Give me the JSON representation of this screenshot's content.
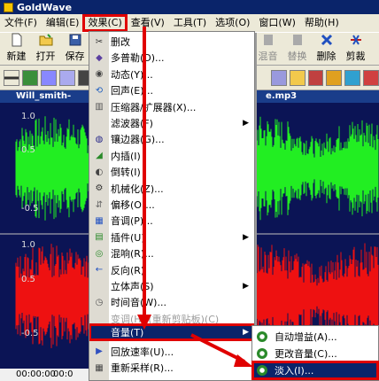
{
  "window": {
    "title": "GoldWave"
  },
  "menubar": [
    {
      "label": "文件(F)"
    },
    {
      "label": "编辑(E)"
    },
    {
      "label": "效果(C)",
      "active": true
    },
    {
      "label": "查看(V)"
    },
    {
      "label": "工具(T)"
    },
    {
      "label": "选项(O)"
    },
    {
      "label": "窗口(W)"
    },
    {
      "label": "帮助(H)"
    }
  ],
  "toolbar": [
    {
      "label": "新建",
      "icon": "new-file-icon"
    },
    {
      "label": "打开",
      "icon": "open-folder-icon"
    },
    {
      "label": "保存",
      "icon": "save-icon"
    },
    {
      "label": "新",
      "icon": "new-icon"
    },
    {
      "label": "混音",
      "icon": "mix-icon"
    },
    {
      "label": "替换",
      "icon": "replace-icon"
    },
    {
      "label": "删除",
      "icon": "delete-icon"
    },
    {
      "label": "剪裁",
      "icon": "trim-icon"
    }
  ],
  "document": {
    "title_left": "Will_smith-",
    "title_right": "e.mp3"
  },
  "waveform": {
    "y_labels_top": [
      "1.0",
      "0.5",
      "-0.5"
    ],
    "y_labels_bottom": [
      "1.0",
      "0.5",
      "-0.5"
    ],
    "ruler_left": "00:00:00",
    "ruler_right": "00:0"
  },
  "effects_menu": [
    {
      "label": "删改",
      "icon": "delete-icon"
    },
    {
      "label": "多普勒(D)...",
      "icon": "doppler-icon"
    },
    {
      "label": "动态(Y)...",
      "icon": "dynamics-icon"
    },
    {
      "label": "回声(E)...",
      "icon": "echo-icon"
    },
    {
      "label": "压缩器/扩展器(X)...",
      "icon": "compressor-icon"
    },
    {
      "label": "滤波器(F)",
      "icon": "",
      "submenu": true
    },
    {
      "label": "镶边器(G)...",
      "icon": "flanger-icon"
    },
    {
      "label": "内插(I)",
      "icon": "interpolate-icon"
    },
    {
      "label": "倒转(I)",
      "icon": "invert-icon"
    },
    {
      "label": "机械化(Z)...",
      "icon": "mechanize-icon"
    },
    {
      "label": "偏移(O)...",
      "icon": "offset-icon"
    },
    {
      "label": "音调(P)...",
      "icon": "pitch-icon"
    },
    {
      "label": "插件(U)",
      "icon": "plugin-icon",
      "submenu": true
    },
    {
      "label": "混响(R)...",
      "icon": "reverb-icon"
    },
    {
      "label": "反向(R)",
      "icon": "reverse-icon"
    },
    {
      "label": "立体声(S)",
      "icon": "",
      "submenu": true
    },
    {
      "label": "时间音(W)...",
      "icon": "time-icon"
    },
    {
      "label": "变调(H)  (重新剪贴板)(C)",
      "icon": "",
      "disabled": true
    },
    {
      "label": "音量(T)",
      "icon": "",
      "submenu": true,
      "highlight": true
    },
    {
      "label": "回放速率(U)...",
      "icon": "playback-rate-icon"
    },
    {
      "label": "重新采样(R)...",
      "icon": "resample-icon"
    }
  ],
  "volume_submenu": [
    {
      "label": "自动增益(A)...",
      "icon": "auto-gain-icon"
    },
    {
      "label": "更改音量(C)...",
      "icon": "change-volume-icon"
    },
    {
      "label": "淡入(I)...",
      "icon": "fade-in-icon",
      "highlight": true
    }
  ],
  "colors": {
    "wave_green": "#22ee22",
    "wave_red": "#ee1111",
    "wave_bg": "#0b1455",
    "highlight_red": "#e00000",
    "selection_blue": "#0a246a"
  }
}
